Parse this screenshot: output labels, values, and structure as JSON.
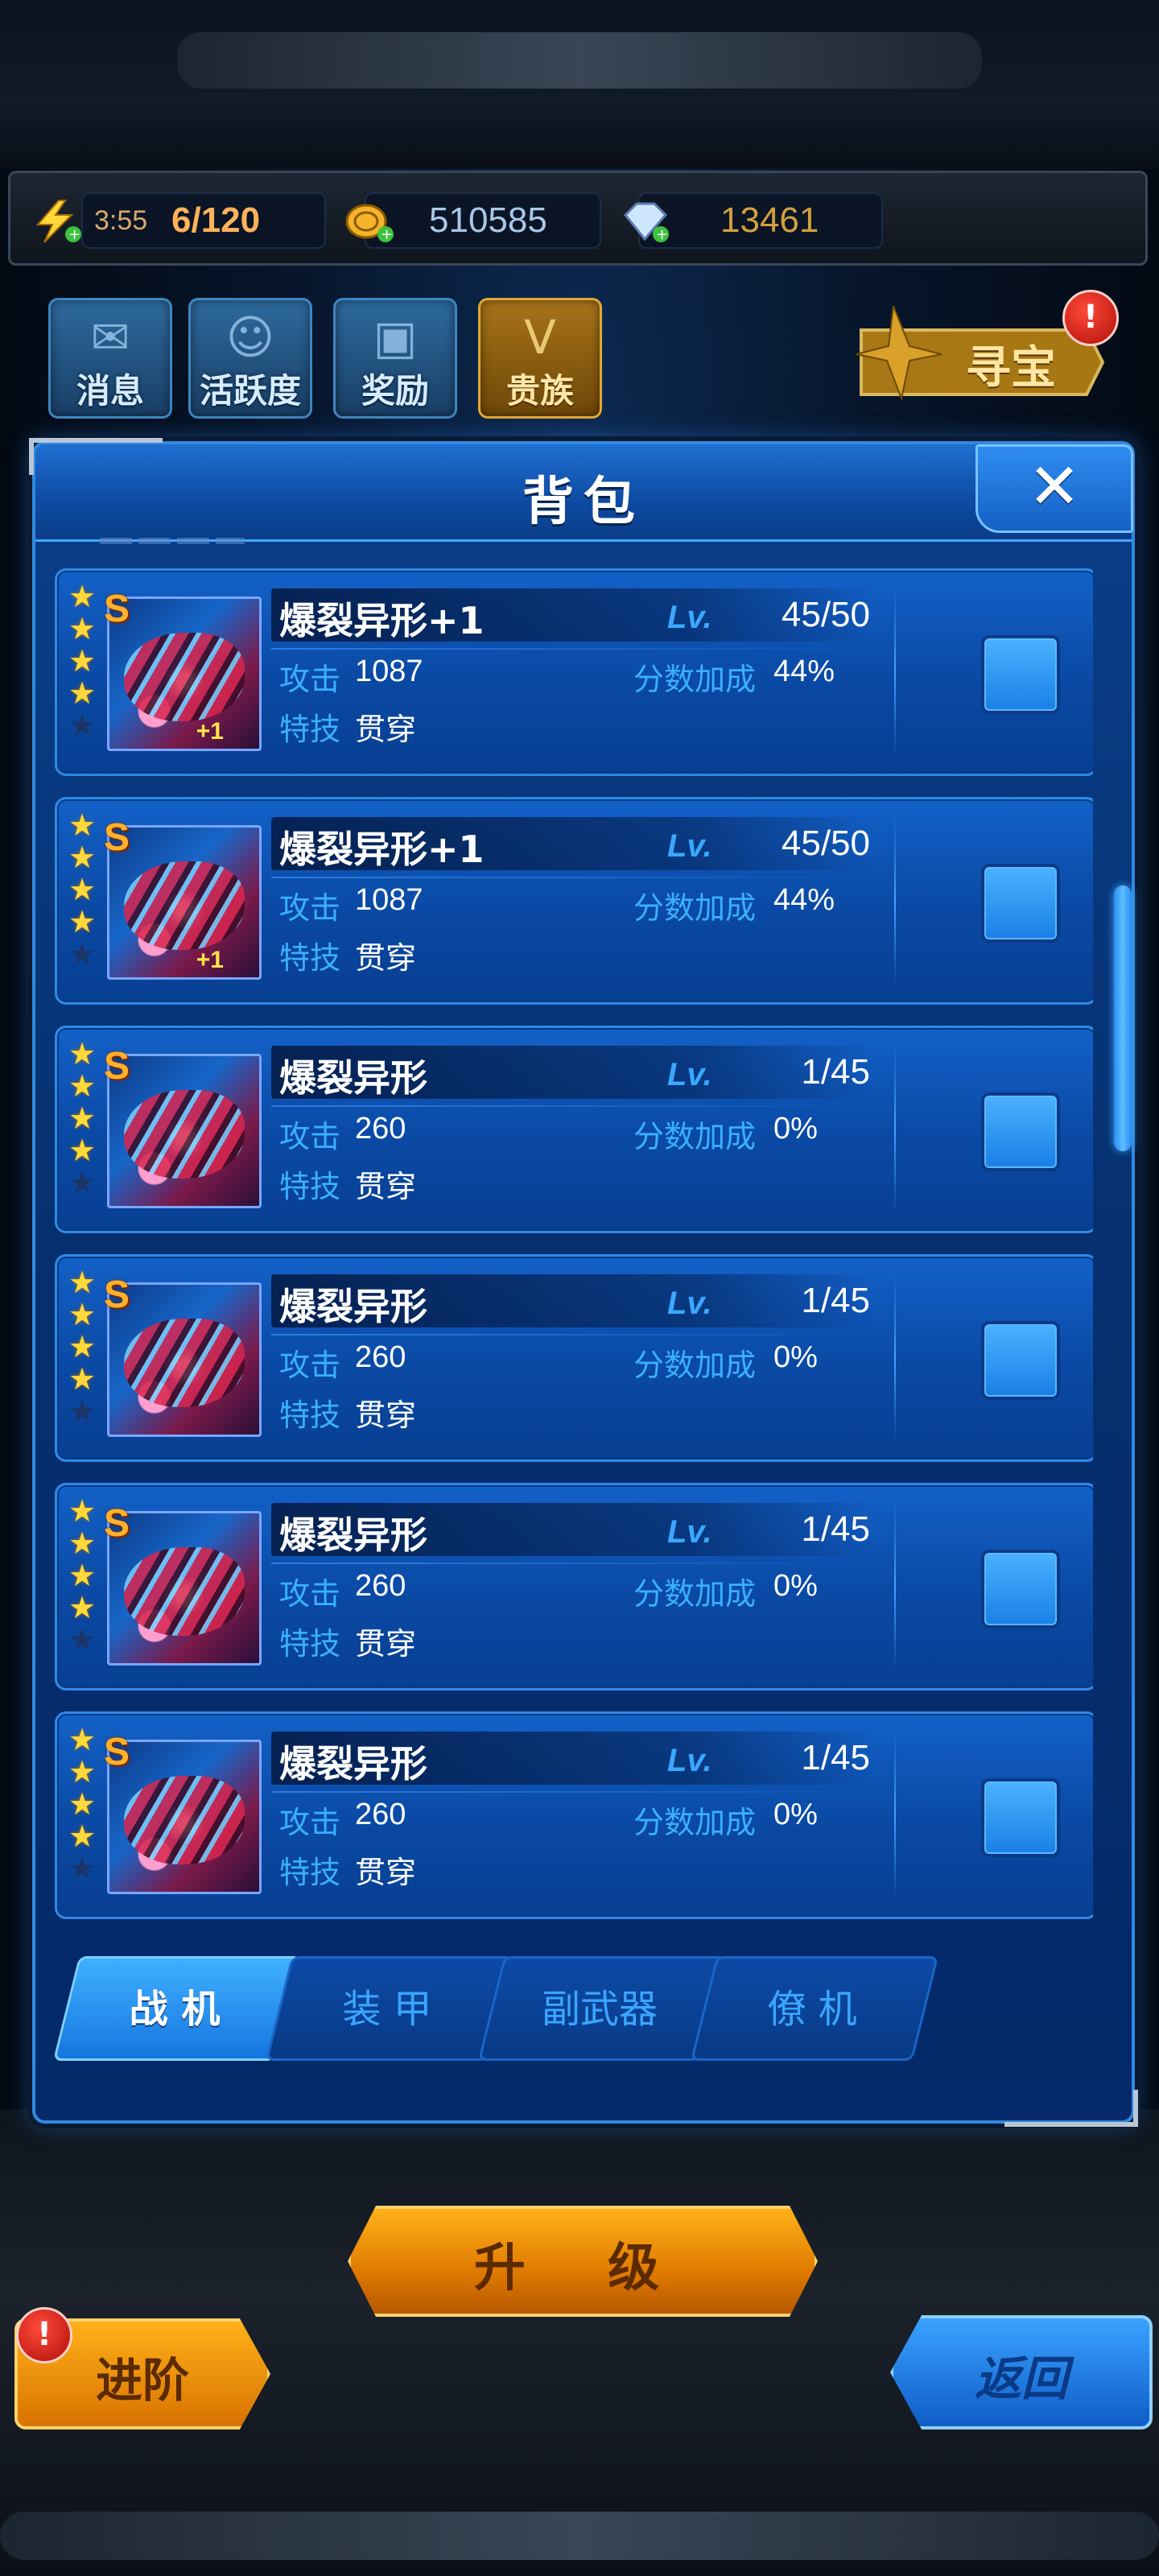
{
  "resources": {
    "energy_timer": "3:55",
    "energy": "6/120",
    "gold": "510585",
    "gems": "13461"
  },
  "menu": [
    {
      "label": "消息",
      "icon": "mail-icon"
    },
    {
      "label": "活跃度",
      "icon": "smiley-wings-icon"
    },
    {
      "label": "奖励",
      "icon": "gift-icon"
    },
    {
      "label": "贵族",
      "icon": "noble-v-icon"
    }
  ],
  "treasure": {
    "label": "寻宝",
    "badge": "!"
  },
  "modal": {
    "title": "背包",
    "close": "✕"
  },
  "labels": {
    "attack": "攻击",
    "skill": "特技",
    "score_bonus": "分数加成",
    "lv": "Lv."
  },
  "items": [
    {
      "name": "爆裂异形+1",
      "grade": "S",
      "stars": 4,
      "plus": "+1",
      "level": "45/50",
      "attack": "1087",
      "bonus": "44%",
      "skill": "贯穿"
    },
    {
      "name": "爆裂异形+1",
      "grade": "S",
      "stars": 4,
      "plus": "+1",
      "level": "45/50",
      "attack": "1087",
      "bonus": "44%",
      "skill": "贯穿"
    },
    {
      "name": "爆裂异形",
      "grade": "S",
      "stars": 4,
      "plus": "",
      "level": "1/45",
      "attack": "260",
      "bonus": "0%",
      "skill": "贯穿"
    },
    {
      "name": "爆裂异形",
      "grade": "S",
      "stars": 4,
      "plus": "",
      "level": "1/45",
      "attack": "260",
      "bonus": "0%",
      "skill": "贯穿"
    },
    {
      "name": "爆裂异形",
      "grade": "S",
      "stars": 4,
      "plus": "",
      "level": "1/45",
      "attack": "260",
      "bonus": "0%",
      "skill": "贯穿"
    },
    {
      "name": "爆裂异形",
      "grade": "S",
      "stars": 4,
      "plus": "",
      "level": "1/45",
      "attack": "260",
      "bonus": "0%",
      "skill": "贯穿"
    }
  ],
  "tabs": [
    {
      "label": "战 机",
      "active": true
    },
    {
      "label": "装 甲",
      "active": false
    },
    {
      "label": "副武器",
      "active": false
    },
    {
      "label": "僚 机",
      "active": false
    }
  ],
  "buttons": {
    "upgrade": "升 级",
    "advance": "进阶",
    "advance_badge": "!",
    "back": "返回"
  },
  "colors": {
    "accent_blue": "#2f8ae0",
    "label_blue": "#3ab0ff",
    "gold": "#ffb11a",
    "star": "#ffd83a"
  }
}
